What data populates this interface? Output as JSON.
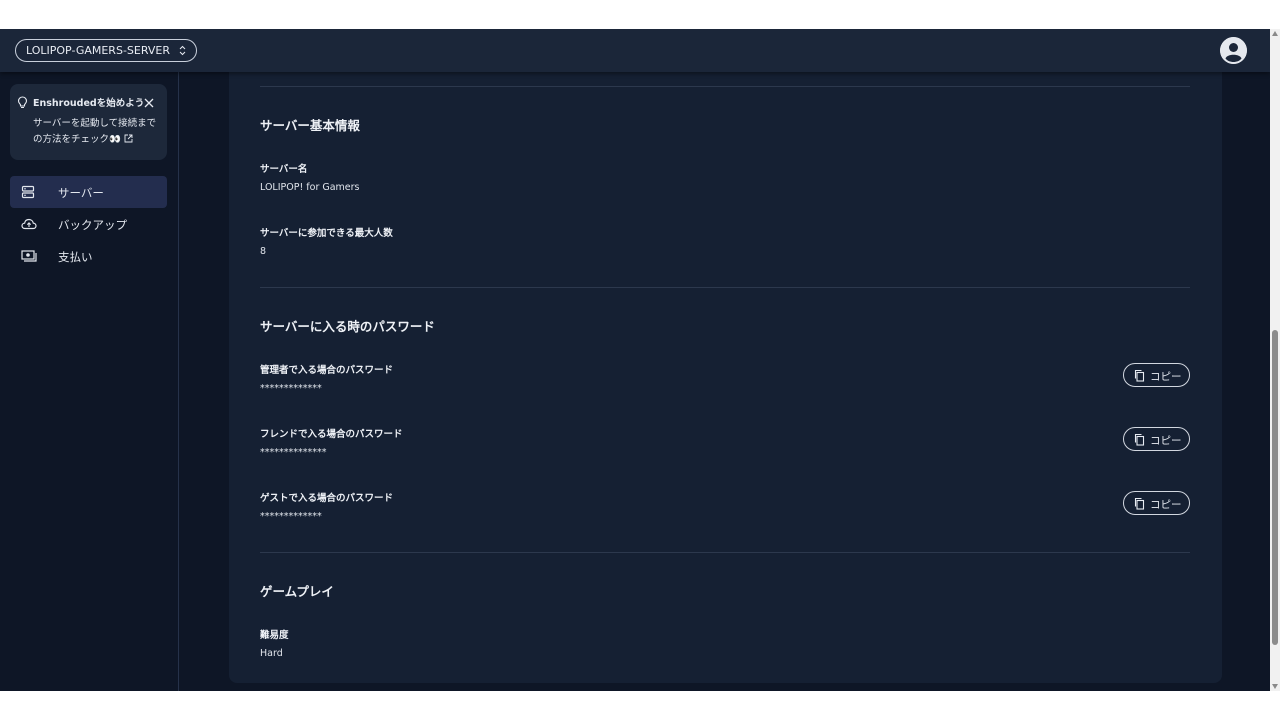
{
  "header": {
    "server_selector": "LOLIPOP-GAMERS-SERVER",
    "chevron_icon": "unfold-chevrons-icon",
    "avatar_icon": "account-circle-icon"
  },
  "sidebar": {
    "tip": {
      "title": "Enshroudedを始めよう",
      "body_line1": "サーバーを起動して接続まで",
      "body_line2": "の方法をチェック",
      "emoji": "👀",
      "icons": [
        "lightbulb-icon",
        "close-icon",
        "external-link-icon"
      ]
    },
    "items": [
      {
        "label": "サーバー",
        "icon": "server-icon",
        "active": true
      },
      {
        "label": "バックアップ",
        "icon": "cloud-upload-icon",
        "active": false
      },
      {
        "label": "支払い",
        "icon": "payment-icon",
        "active": false
      }
    ]
  },
  "main": {
    "basic_info": {
      "title": "サーバー基本情報",
      "server_name_label": "サーバー名",
      "server_name_value": "LOLIPOP! for Gamers",
      "max_players_label": "サーバーに参加できる最大人数",
      "max_players_value": "8"
    },
    "passwords": {
      "title": "サーバーに入る時のパスワード",
      "items": [
        {
          "label": "管理者で入る場合のパスワード",
          "value": "*************",
          "button": "コピー"
        },
        {
          "label": "フレンドで入る場合のパスワード",
          "value": "**************",
          "button": "コピー"
        },
        {
          "label": "ゲストで入る場合のパスワード",
          "value": "*************",
          "button": "コピー"
        }
      ]
    },
    "gameplay": {
      "title": "ゲームプレイ",
      "difficulty_label": "難易度",
      "difficulty_value": "Hard"
    }
  },
  "colors": {
    "background": "#0e1626",
    "topbar": "#1b2639",
    "card": "#152033",
    "active_nav": "#232d4e"
  }
}
